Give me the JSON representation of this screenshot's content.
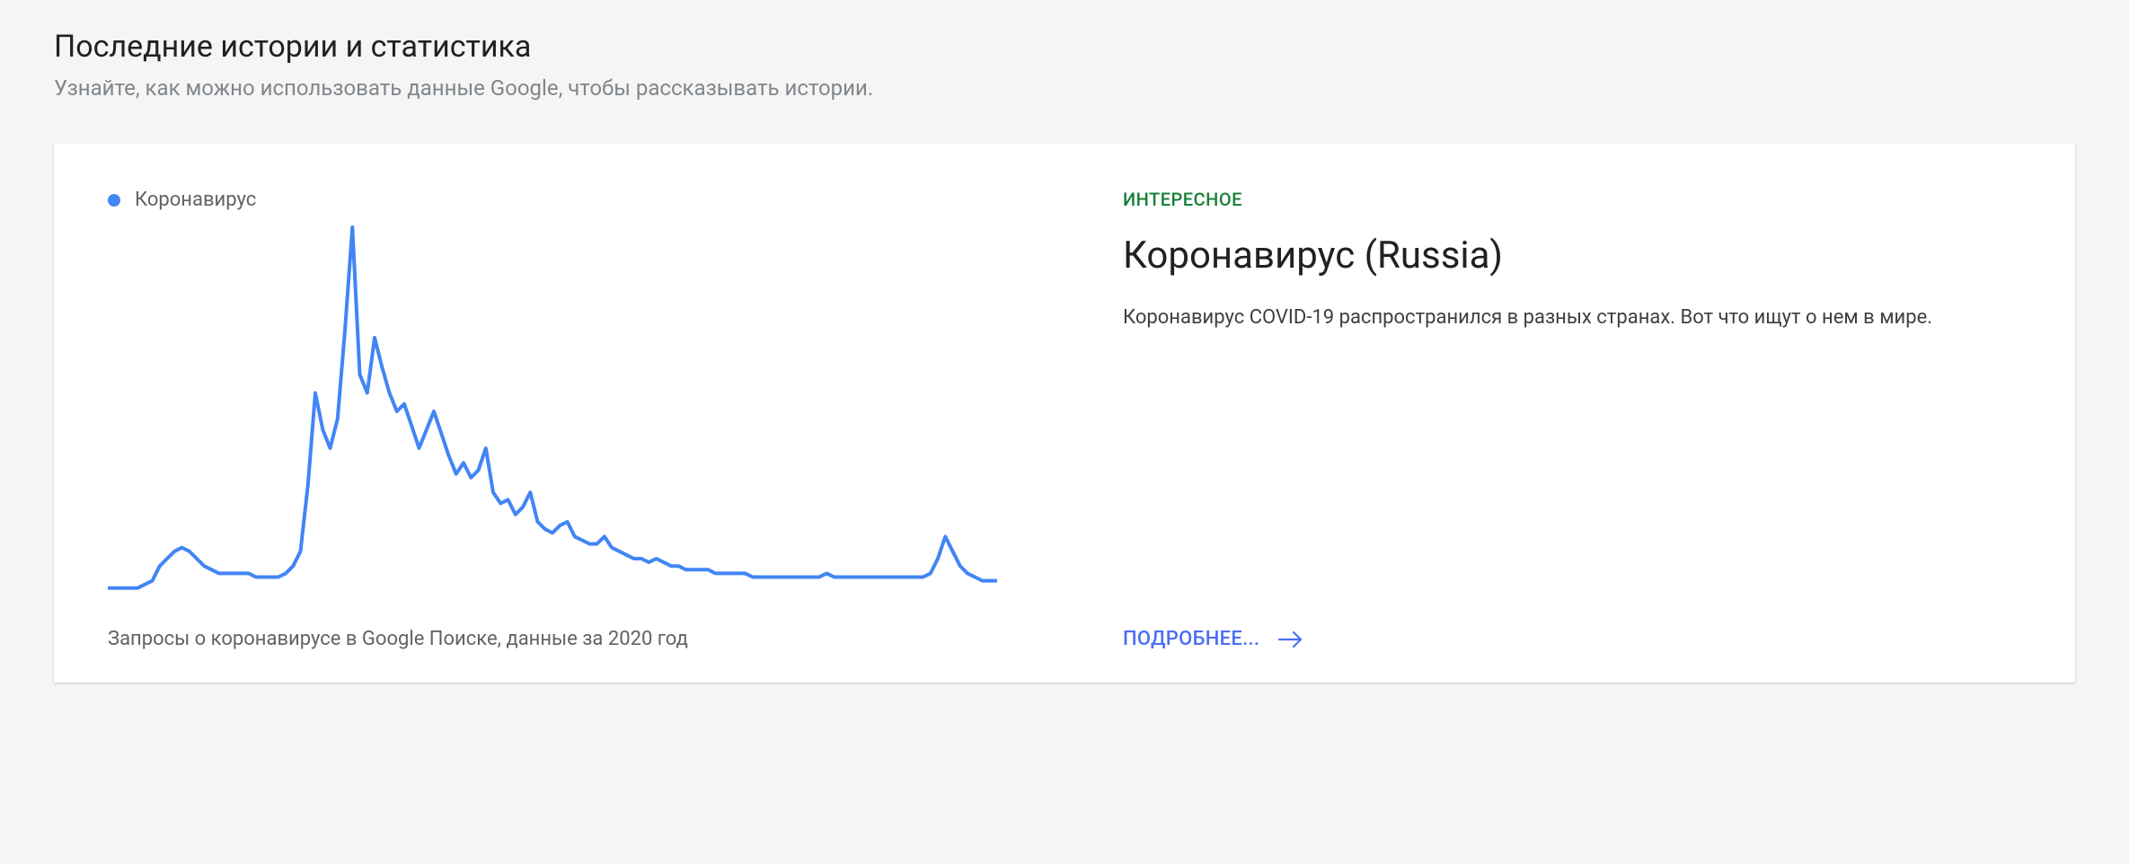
{
  "header": {
    "title": "Последние истории и статистика",
    "subtitle": "Узнайте, как можно использовать данные Google, чтобы рассказывать истории."
  },
  "card": {
    "legend_label": "Коронавирус",
    "caption": "Запросы о коронавирусе в Google Поиске, данные за 2020 год",
    "eyebrow": "ИНТЕРЕСНОЕ",
    "title": "Коронавирус (Russia)",
    "description": "Коронавирус COVID-19 распространился в разных странах. Вот что ищут о нем в мире.",
    "more_label": "ПОДРОБНЕЕ..."
  },
  "colors": {
    "primary": "#4285f4",
    "accent_green": "#188038",
    "link_blue": "#4c6ef5"
  },
  "chart_data": {
    "type": "line",
    "title": "",
    "xlabel": "",
    "ylabel": "",
    "ylim": [
      0,
      100
    ],
    "series": [
      {
        "name": "Коронавирус",
        "color": "#4285f4",
        "values": [
          2,
          2,
          2,
          2,
          2,
          3,
          4,
          8,
          10,
          12,
          13,
          12,
          10,
          8,
          7,
          6,
          6,
          6,
          6,
          6,
          5,
          5,
          5,
          5,
          6,
          8,
          12,
          30,
          55,
          45,
          40,
          48,
          72,
          100,
          60,
          55,
          70,
          62,
          55,
          50,
          52,
          46,
          40,
          45,
          50,
          44,
          38,
          33,
          36,
          32,
          34,
          40,
          28,
          25,
          26,
          22,
          24,
          28,
          20,
          18,
          17,
          19,
          20,
          16,
          15,
          14,
          14,
          16,
          13,
          12,
          11,
          10,
          10,
          9,
          10,
          9,
          8,
          8,
          7,
          7,
          7,
          7,
          6,
          6,
          6,
          6,
          6,
          5,
          5,
          5,
          5,
          5,
          5,
          5,
          5,
          5,
          5,
          6,
          5,
          5,
          5,
          5,
          5,
          5,
          5,
          5,
          5,
          5,
          5,
          5,
          5,
          6,
          10,
          16,
          12,
          8,
          6,
          5,
          4,
          4,
          4
        ]
      }
    ]
  }
}
